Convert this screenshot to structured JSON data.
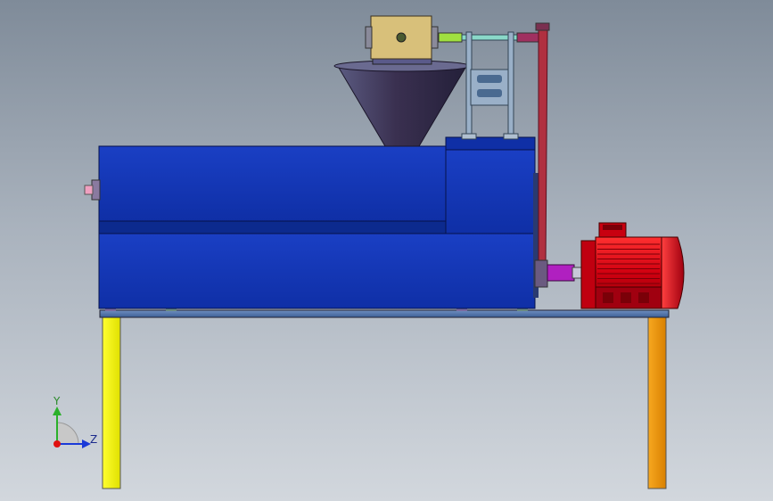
{
  "viewport": {
    "background_top": "#7f8b99",
    "background_bottom": "#d2d7dd"
  },
  "machine": {
    "body_color": "#1133b0",
    "frame_color": "#5a7fae",
    "legs": {
      "left_color": "#ffff00",
      "right_color": "#f0960a"
    },
    "hopper_color": "#3a3050",
    "gearbox_color": "#d8c07a",
    "belt_color": "#b03040",
    "motor_color": "#e00010",
    "coupling_color": "#b020c0"
  },
  "triad": {
    "y_label": "Y",
    "z_label": "Z",
    "y_color": "#2ab02a",
    "z_color": "#1a3ad8",
    "origin_color": "#e01010"
  }
}
